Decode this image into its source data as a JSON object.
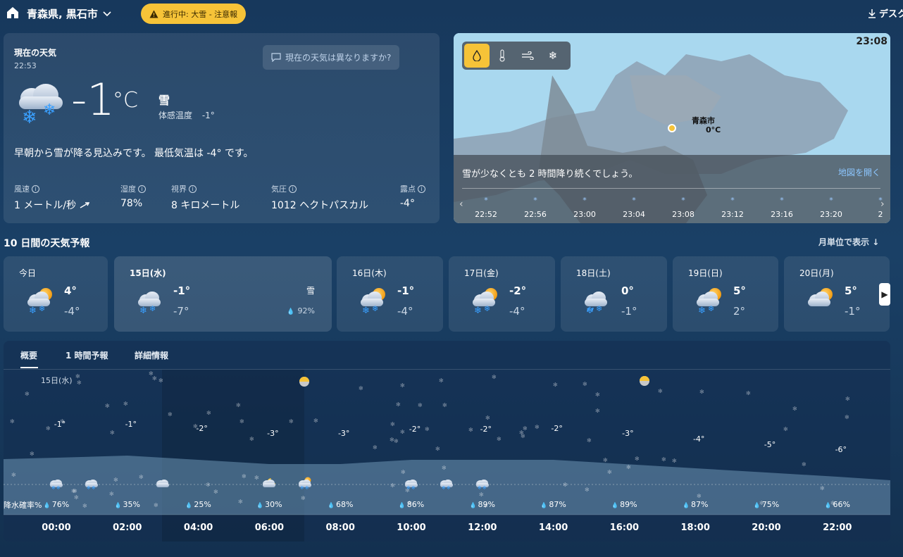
{
  "header": {
    "location": "青森県, 黒石市",
    "alert": "進行中: 大雪 - 注意報",
    "download": "デスク"
  },
  "current": {
    "title": "現在の天気",
    "time": "22:53",
    "diff_question": "現在の天気は異なりますか?",
    "temp": "-1",
    "unit": "°C",
    "condition": "雪",
    "feels_label": "体感温度",
    "feels_value": "-1°",
    "summary": "早朝から雪が降る見込みです。 最低気温は -4° です。",
    "metrics": [
      {
        "label": "風速",
        "value": "1 メートル/秒"
      },
      {
        "label": "湿度",
        "value": "78%"
      },
      {
        "label": "視界",
        "value": "8 キロメートル"
      },
      {
        "label": "気圧",
        "value": "1012 ヘクトパスカル"
      },
      {
        "label": "露点",
        "value": "-4°"
      }
    ]
  },
  "map": {
    "time": "23:08",
    "city": "青森市",
    "city_temp": "0°C",
    "message": "雪が少なくとも 2 時間降り続くでしょう。",
    "open": "地図を開く",
    "timeline": [
      "22:52",
      "22:56",
      "23:00",
      "23:04",
      "23:08",
      "23:12",
      "23:16",
      "23:20",
      "2"
    ]
  },
  "forecast": {
    "title": "10 日間の天気予報",
    "monthly": "月単位で表示",
    "days": [
      {
        "name": "今日",
        "hi": "4°",
        "lo": "-4°",
        "icon": "snow-sun-icon"
      },
      {
        "name": "15日(水)",
        "hi": "-1°",
        "lo": "-7°",
        "cond": "雪",
        "prob": "92%",
        "icon": "snow-icon"
      },
      {
        "name": "16日(木)",
        "hi": "-1°",
        "lo": "-4°",
        "icon": "snow-sun-icon"
      },
      {
        "name": "17日(金)",
        "hi": "-2°",
        "lo": "-4°",
        "icon": "snow-sun-icon"
      },
      {
        "name": "18日(土)",
        "hi": "0°",
        "lo": "-1°",
        "icon": "rain-cloud-icon"
      },
      {
        "name": "19日(日)",
        "hi": "5°",
        "lo": "2°",
        "icon": "snow-sun-icon"
      },
      {
        "name": "20日(月)",
        "hi": "5°",
        "lo": "-1°",
        "icon": "partly-cloudy-icon"
      }
    ]
  },
  "hourly": {
    "tabs": [
      "概要",
      "1 時間予報",
      "詳細情報"
    ],
    "day_label": "15日(水)",
    "precip_title": "降水確率%",
    "temps": [
      "-1°",
      "-1°",
      "-2°",
      "-3°",
      "-3°",
      "-2°",
      "-2°",
      "-2°",
      "-3°",
      "-4°",
      "-5°",
      "-6°"
    ],
    "probs": [
      "76%",
      "35%",
      "25%",
      "30%",
      "68%",
      "86%",
      "89%",
      "87%",
      "89%",
      "87%",
      "75%",
      "66%"
    ],
    "hours": [
      "00:00",
      "02:00",
      "04:00",
      "06:00",
      "08:00",
      "10:00",
      "12:00",
      "14:00",
      "16:00",
      "18:00",
      "20:00",
      "22:00"
    ]
  }
}
